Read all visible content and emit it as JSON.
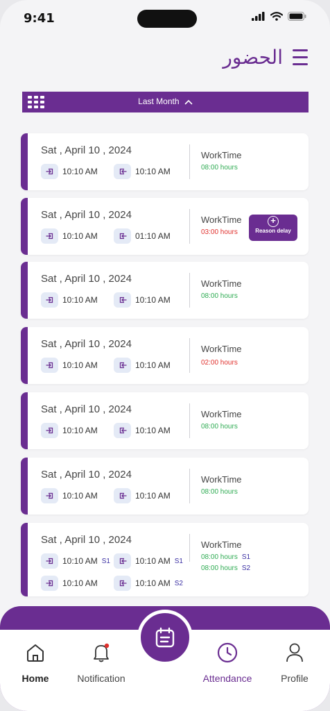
{
  "status_bar": {
    "time": "9:41"
  },
  "header": {
    "title": "الحضور"
  },
  "filter": {
    "label": "Last Month"
  },
  "work_label": "WorkTime",
  "reason_label": "Reason delay",
  "cards": [
    {
      "date": "Sat , April 10 , 2024",
      "in": "10:10 AM",
      "out": "10:10 AM",
      "hours": "08:00 hours",
      "status": "ok"
    },
    {
      "date": "Sat , April 10 , 2024",
      "in": "10:10 AM",
      "out": "01:10 AM",
      "hours": "03:00 hours",
      "status": "late"
    },
    {
      "date": "Sat , April 10 , 2024",
      "in": "10:10 AM",
      "out": "10:10 AM",
      "hours": "08:00 hours",
      "status": "ok"
    },
    {
      "date": "Sat , April 10 , 2024",
      "in": "10:10 AM",
      "out": "10:10 AM",
      "hours": "02:00 hours",
      "status": "late"
    },
    {
      "date": "Sat , April 10 , 2024",
      "in": "10:10 AM",
      "out": "10:10 AM",
      "hours": "08:00 hours",
      "status": "ok"
    },
    {
      "date": "Sat , April 10 , 2024",
      "in": "10:10 AM",
      "out": "10:10 AM",
      "hours": "08:00 hours",
      "status": "ok"
    },
    {
      "date": "Sat , April 10 , 2024",
      "in": "10:10 AM",
      "out": "10:10 AM",
      "shift1": "S1",
      "in2": "10:10 AM",
      "shift2": "S2",
      "hours": "08:00 hours",
      "hours_tag1": "S1",
      "hours2": "08:00 hours",
      "hours_tag2": "S2",
      "status": "ok"
    }
  ],
  "nav": {
    "home": "Home",
    "notification": "Notification",
    "attendance": "Attendance",
    "profile": "Profile"
  },
  "colors": {
    "accent": "#6a2d91",
    "ok": "#2eab52",
    "late": "#e0302d",
    "chip": "#e4eaf6"
  },
  "icons": [
    "menu-icon",
    "grid-icon",
    "chevron-up-icon",
    "check-in-icon",
    "check-out-icon",
    "plus-icon",
    "home-icon",
    "bell-icon",
    "calendar-icon",
    "clock-icon",
    "user-icon"
  ]
}
